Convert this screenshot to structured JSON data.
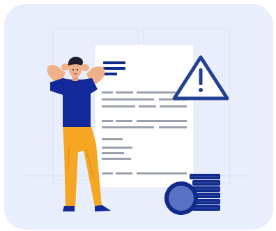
{
  "illustration": {
    "figure": "stressed-man-holding-head",
    "document": "text-document-with-lines",
    "alert": "warning-triangle-icon",
    "coins": "coin-stack-icon"
  },
  "colors": {
    "card_background": "#e8eefc",
    "panel_outline": "#dde5f7",
    "document_paper": "#ffffff",
    "document_lines": "#9aa1ad",
    "accent_navy": "#0f2a8a",
    "warning_stroke": "#233f92",
    "shirt": "#13299a",
    "pants": "#f5a623",
    "skin": "#f0b089",
    "hair": "#1d1d2b",
    "coin_face": "#5b72c4"
  }
}
